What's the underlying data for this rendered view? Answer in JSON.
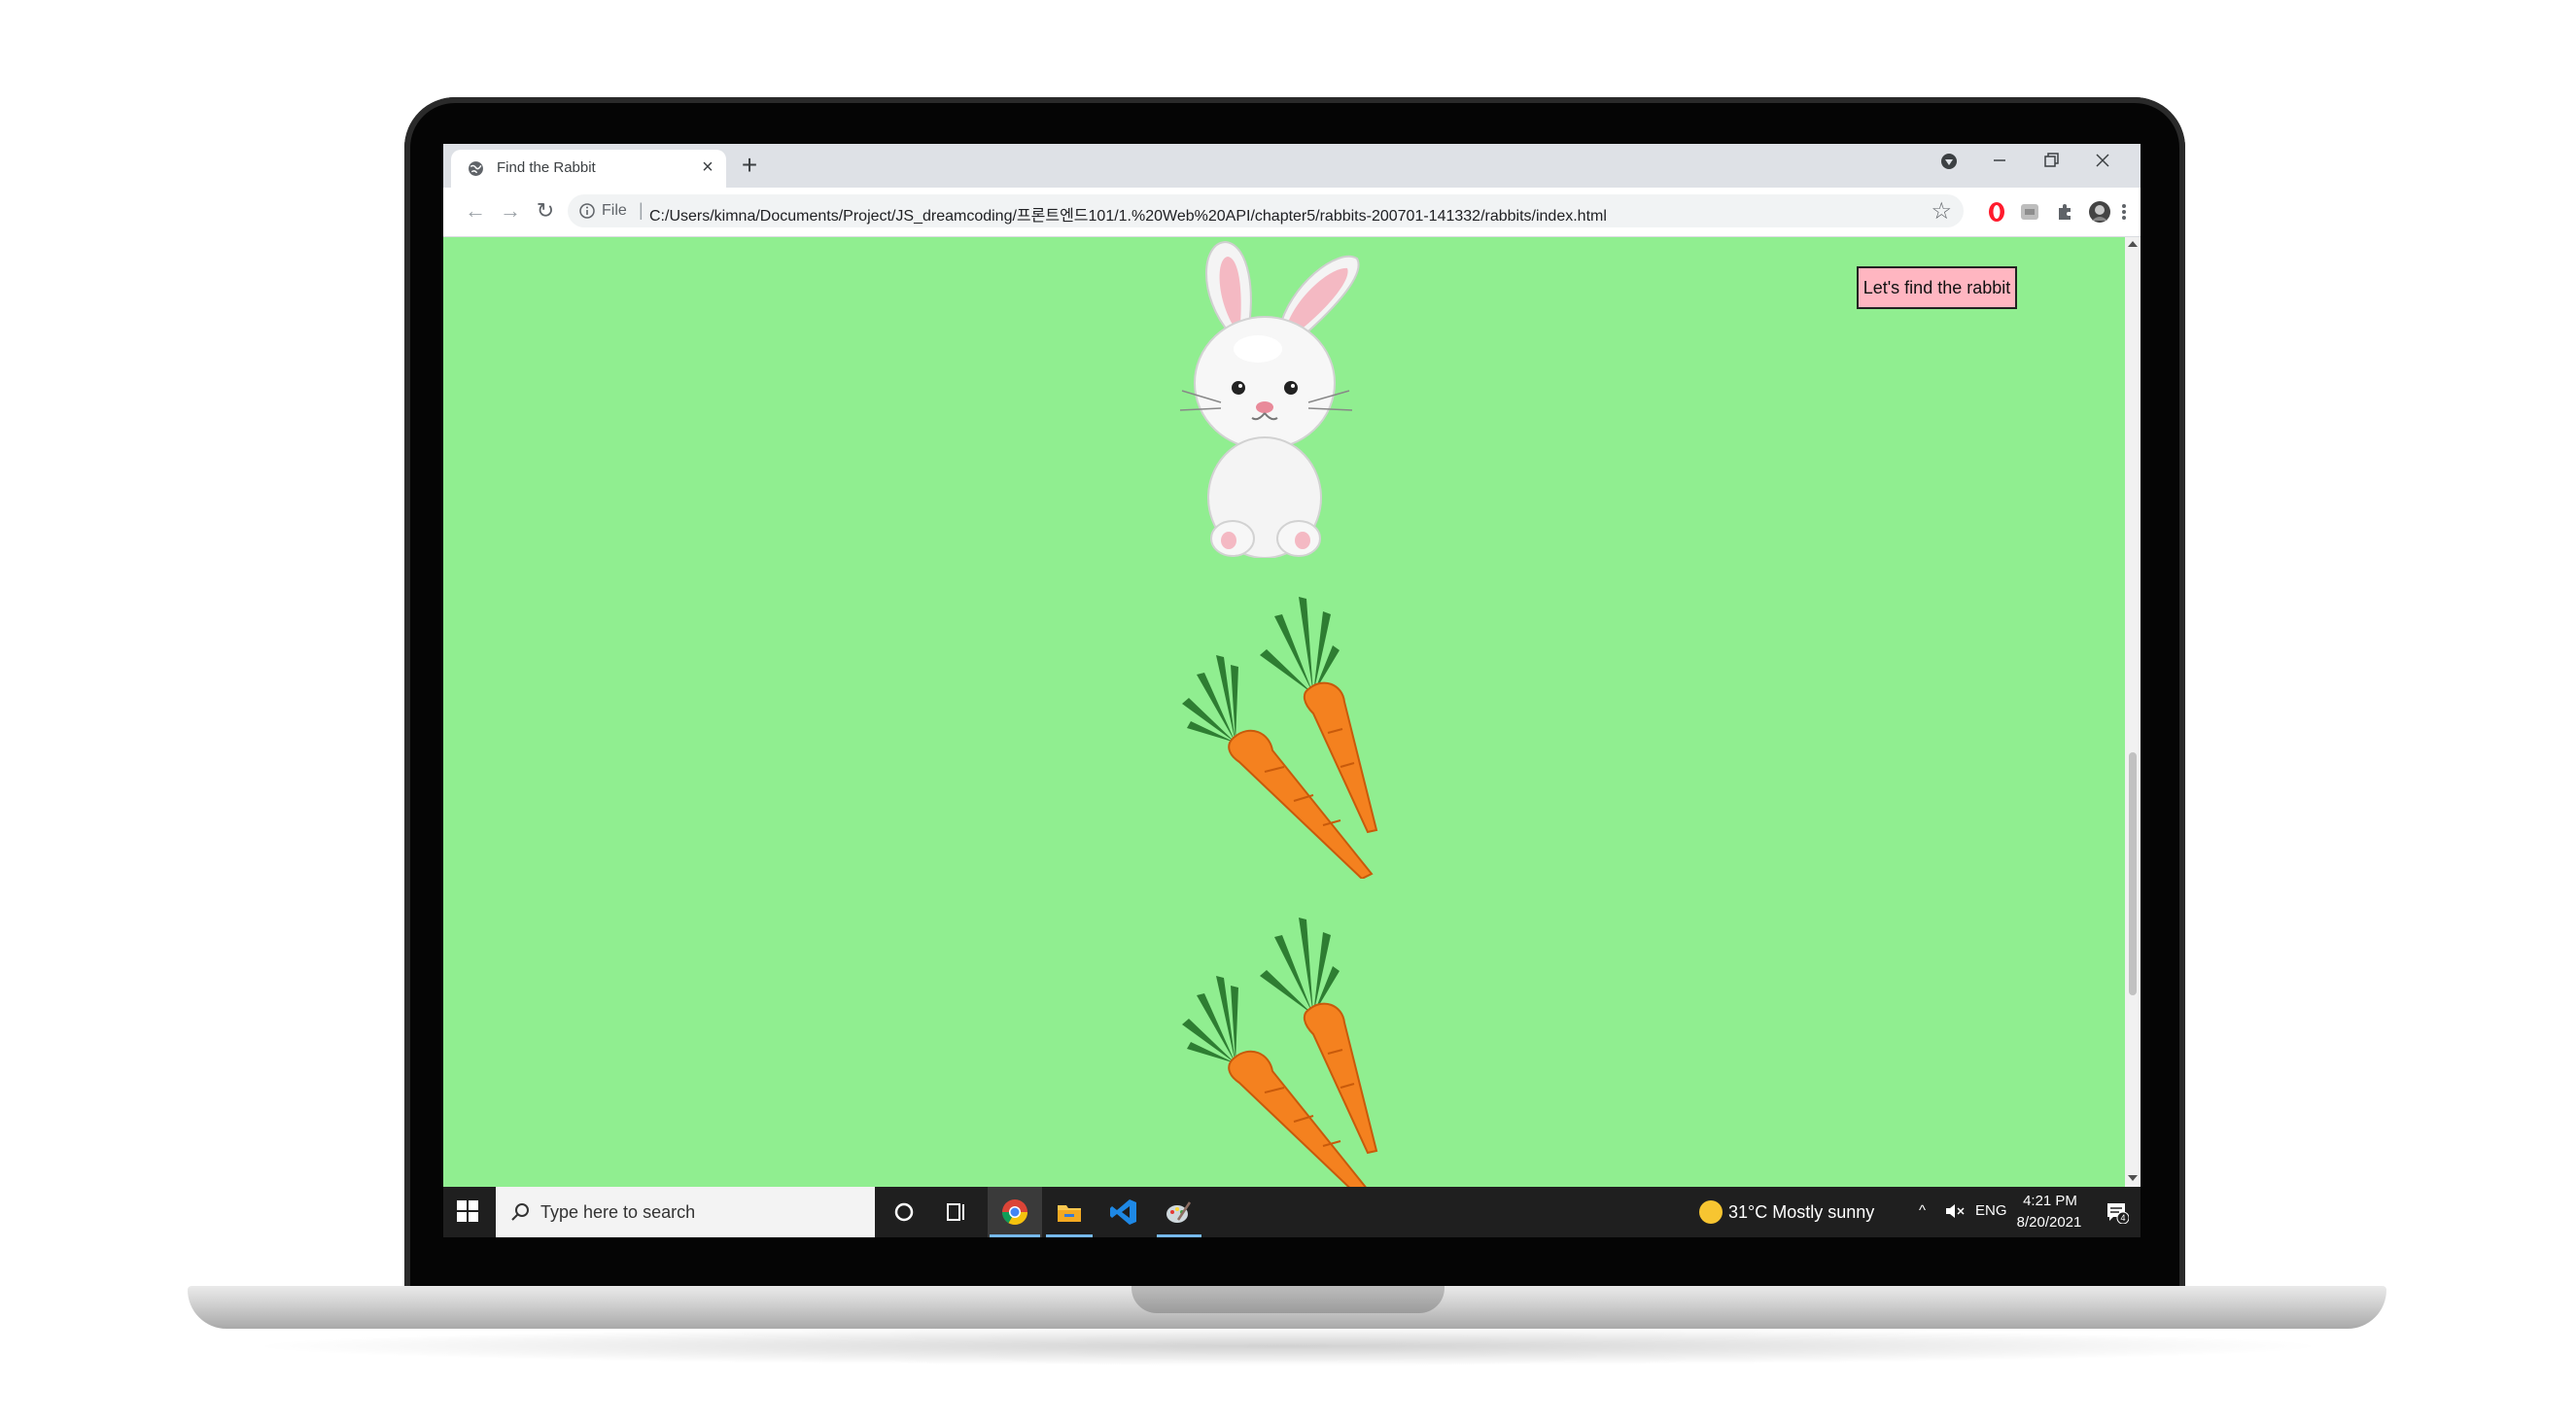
{
  "browser": {
    "tab_title": "Find the Rabbit",
    "new_tab": "+",
    "tab_close": "×",
    "scheme": "File",
    "separator": "|",
    "url": "C:/Users/kimna/Documents/Project/JS_dreamcoding/프론트엔드101/1.%20Web%20API/chapter5/rabbits-200701-141332/rabbits/index.html"
  },
  "page": {
    "background": "#90ee90",
    "button_label": "Let's find the rabbit",
    "button_color": "#ffb6c1"
  },
  "taskbar": {
    "search_placeholder": "Type here to search",
    "weather": "31°C  Mostly sunny",
    "language": "ENG",
    "time": "4:21 PM",
    "date": "8/20/2021",
    "notifications": "4"
  }
}
